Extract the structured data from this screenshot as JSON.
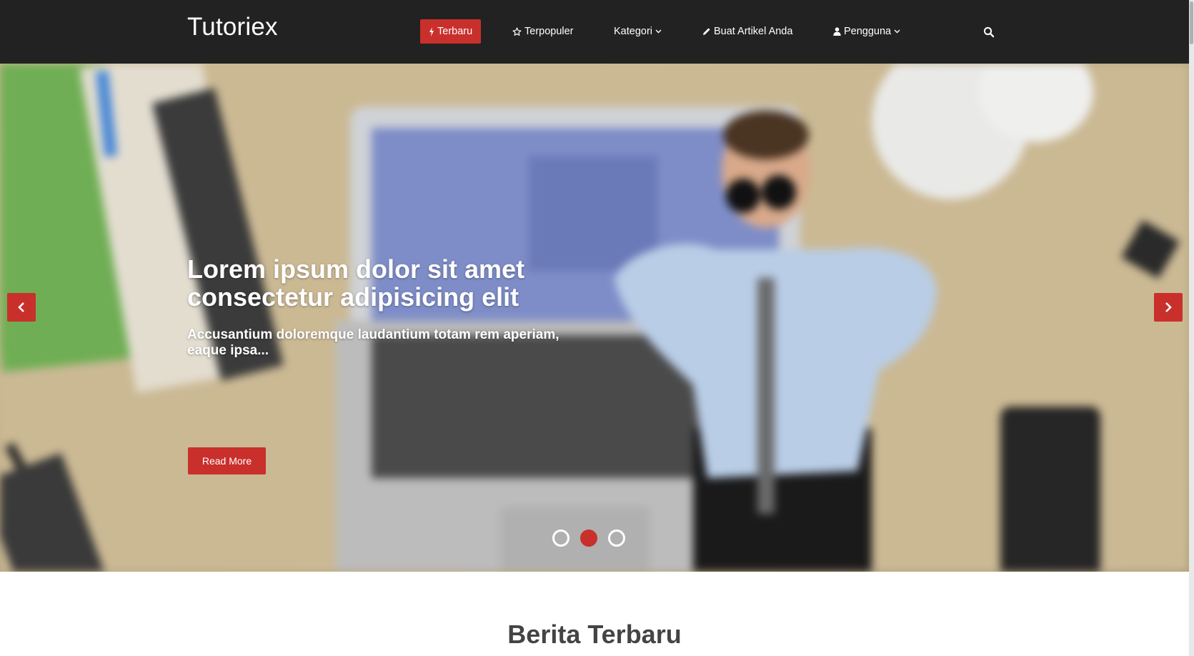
{
  "navbar": {
    "brand": "Tutoriex",
    "items": [
      {
        "label": "Terbaru",
        "icon": "bolt-icon",
        "active": true
      },
      {
        "label": "Terpopuler",
        "icon": "star-icon",
        "active": false
      },
      {
        "label": "Kategori",
        "icon": "chevron-down-icon",
        "active": false
      },
      {
        "label": "Buat Artikel Anda",
        "icon": "pencil-icon",
        "active": false
      },
      {
        "label": "Pengguna",
        "icon": "user-icon",
        "active": false
      }
    ],
    "search_icon": "search-icon"
  },
  "hero": {
    "title": "Lorem ipsum dolor sit amet consectetur adipisicing elit",
    "subtitle": "Accusantium doloremque laudantium totam rem aperiam, eaque ipsa...",
    "button_label": "Read More",
    "slides_total": 3,
    "active_slide": 2
  },
  "main": {
    "section_title": "Berita Terbaru"
  },
  "colors": {
    "accent": "#c9302c",
    "navbar_bg": "#222222",
    "heading_text": "#444444"
  }
}
